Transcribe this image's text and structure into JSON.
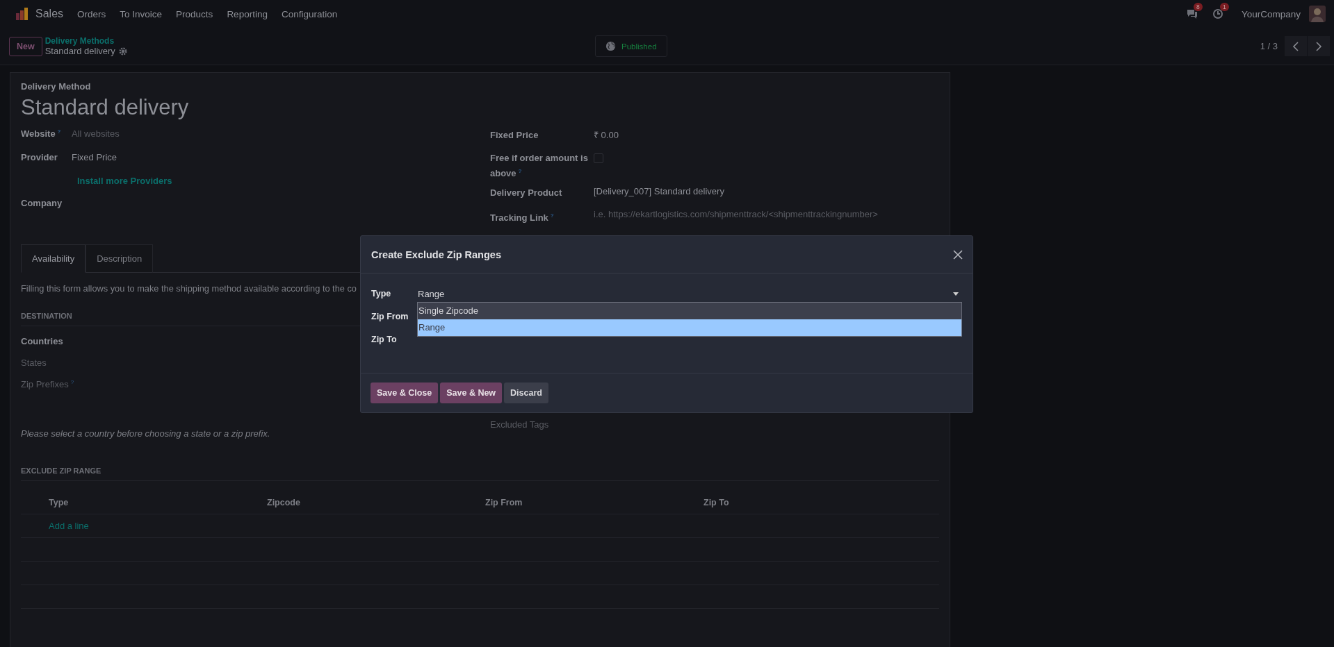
{
  "navbar": {
    "app": "Sales",
    "menu": [
      "Orders",
      "To Invoice",
      "Products",
      "Reporting",
      "Configuration"
    ],
    "messages_badge": "8",
    "activities_badge": "1",
    "company": "YourCompany"
  },
  "control_panel": {
    "new_button": "New",
    "breadcrumb": "Delivery Methods",
    "record": "Standard delivery",
    "published": "Published",
    "pager": "1 / 3"
  },
  "form": {
    "overline": "Delivery Method",
    "title": "Standard delivery",
    "left_fields": [
      {
        "kind": "field",
        "label": "Website",
        "help": "?",
        "placeholder": "All websites"
      },
      {
        "kind": "field",
        "label": "Provider",
        "value": "Fixed Price"
      },
      {
        "kind": "link",
        "value": "Install more Providers"
      },
      {
        "kind": "field",
        "label": "Company"
      }
    ],
    "right_fields": [
      {
        "kind": "field",
        "label": "Fixed Price",
        "value": "₹ 0.00"
      },
      {
        "kind": "checkbox",
        "label": "Free if order amount is above",
        "help": "?",
        "checked": false
      },
      {
        "kind": "field",
        "label": "Delivery Product",
        "value": "[Delivery_007] Standard delivery"
      },
      {
        "kind": "field",
        "label": "Tracking Link",
        "help": "?",
        "placeholder": "i.e. https://ekartlogistics.com/shipmenttrack/<shipmenttrackingnumber>"
      }
    ],
    "tabs": [
      {
        "label": "Availability",
        "selected": true
      },
      {
        "label": "Description",
        "selected": false
      }
    ],
    "intro": "Filling this form allows you to make the shipping method available according to the co",
    "destination": {
      "title": "DESTINATION",
      "fields": [
        {
          "label": "Countries",
          "disabled": false
        },
        {
          "label": "States",
          "disabled": true
        },
        {
          "label": "Zip Prefixes",
          "help": "?",
          "disabled": true
        }
      ]
    },
    "excluded_tags": "Excluded Tags",
    "note": "Please select a country before choosing a state or a zip prefix.",
    "exclude_zip_range": {
      "title": "EXCLUDE ZIP RANGE",
      "columns": [
        "Type",
        "Zipcode",
        "Zip From",
        "Zip To"
      ],
      "add_line": "Add a line"
    }
  },
  "dialog": {
    "title": "Create Exclude Zip Ranges",
    "fields": [
      {
        "kind": "select",
        "label": "Type",
        "value": "Range",
        "options": [
          {
            "label": "Single Zipcode",
            "selected": false
          },
          {
            "label": "Range",
            "selected": true
          }
        ]
      },
      {
        "kind": "input",
        "label": "Zip From"
      },
      {
        "kind": "input",
        "label": "Zip To"
      }
    ],
    "buttons": [
      {
        "label": "Save & Close",
        "kind": "primary"
      },
      {
        "label": "Save & New",
        "kind": "primary"
      },
      {
        "label": "Discard",
        "kind": "secondary"
      }
    ]
  }
}
